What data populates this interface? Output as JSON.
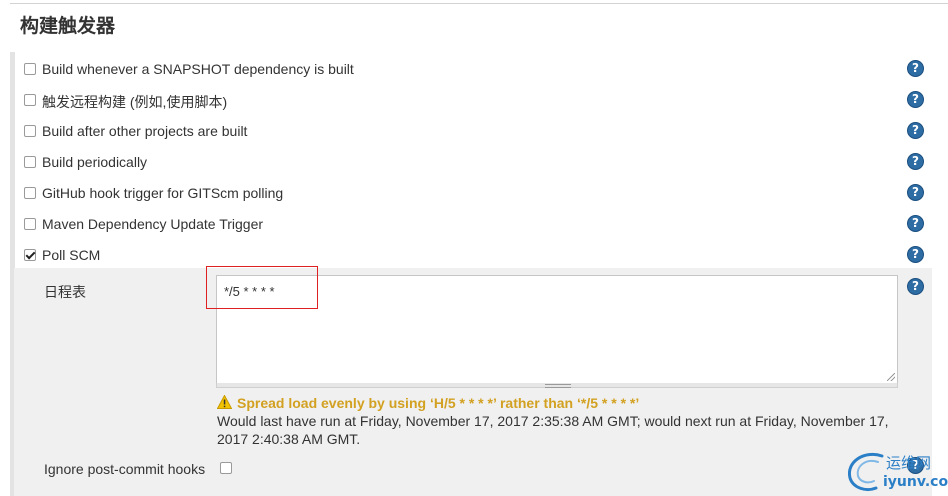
{
  "section": {
    "title": "构建触发器"
  },
  "triggers": [
    {
      "label": "Build whenever a SNAPSHOT dependency is built",
      "checked": false
    },
    {
      "label": "触发远程构建 (例如,使用脚本)",
      "checked": false
    },
    {
      "label": "Build after other projects are built",
      "checked": false
    },
    {
      "label": "Build periodically",
      "checked": false
    },
    {
      "label": "GitHub hook trigger for GITScm polling",
      "checked": false
    },
    {
      "label": "Maven Dependency Update Trigger",
      "checked": false
    },
    {
      "label": "Poll SCM",
      "checked": true
    }
  ],
  "poll_scm": {
    "schedule_label": "日程表",
    "schedule_value": "*/5 * * * *",
    "warning": "Spread load evenly by using ‘H/5 * * * *’ rather than ‘*/5 * * * *’",
    "info": "Would last have run at Friday, November 17, 2017 2:35:38 AM GMT; would next run at Friday, November 17, 2017 2:40:38 AM GMT.",
    "ignore_label": "Ignore post-commit hooks",
    "ignore_checked": false
  },
  "help": {
    "symbol": "?"
  },
  "watermark": {
    "line1": "运维网",
    "line2": "iyunv.com"
  },
  "colors": {
    "warning": "#d3a121",
    "help": "#2e6ca4",
    "highlight": "#e02020",
    "watermark": "#2b7fc7"
  }
}
